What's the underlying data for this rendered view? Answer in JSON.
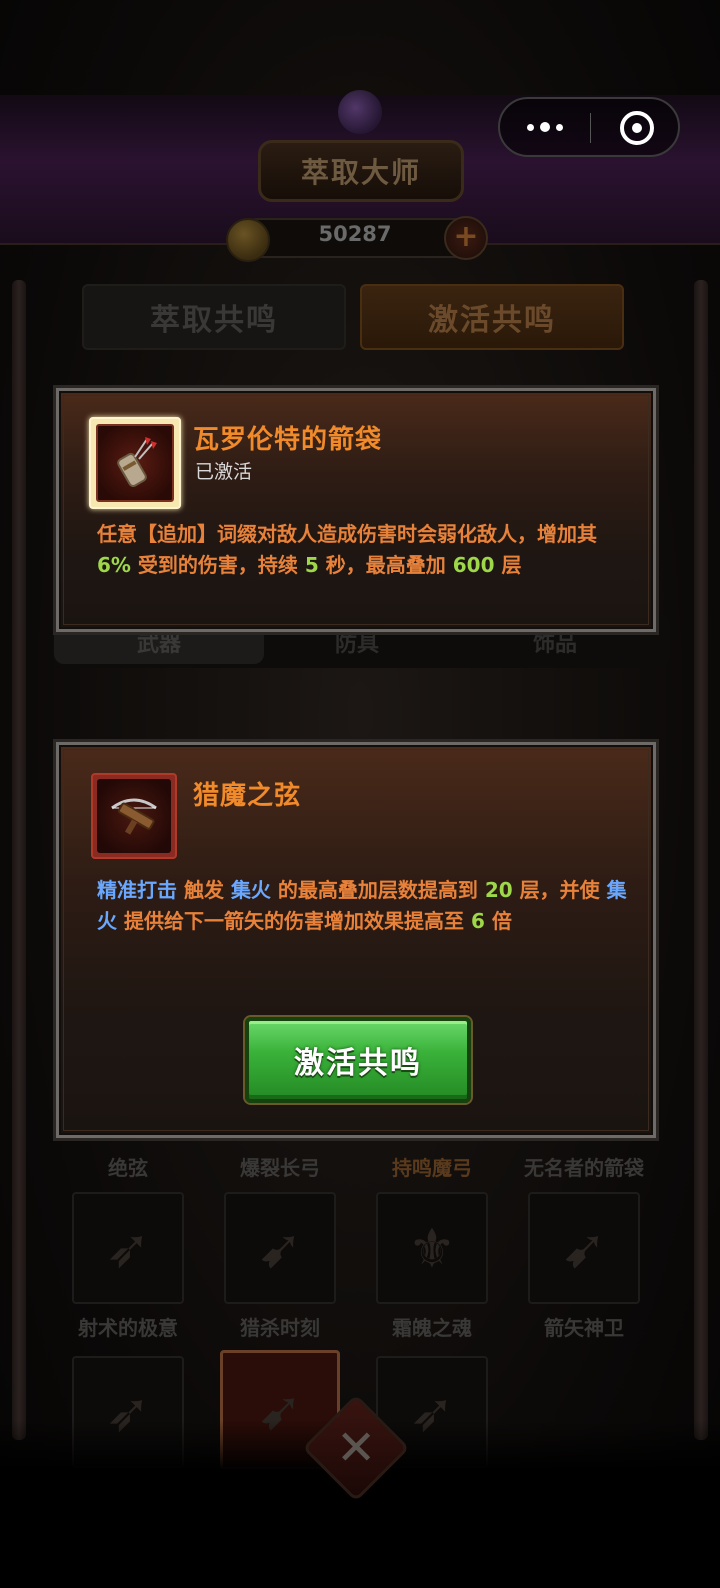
{
  "background": {
    "title": "萃取大师",
    "currency_amount": "50287",
    "tabs": [
      "萃取共鸣",
      "激活共鸣"
    ],
    "sub_tabs": [
      "武器",
      "防具",
      "饰品"
    ],
    "slot_labels_row1": [
      "绝弦",
      "爆裂长弓",
      "持鸣魔弓",
      "无名者的箭袋"
    ],
    "slot_labels_row2": [
      "射术的极意",
      "猎杀时刻",
      "霜魄之魂",
      "箭矢神卫"
    ]
  },
  "capsule": {
    "more_icon": "more-dots-icon",
    "close_icon": "target-circle-icon"
  },
  "panel_quiver": {
    "name": "瓦罗伦特的箭袋",
    "status": "已激活",
    "desc": {
      "p1": "任意【追加】词缀对敌人造成伤害时会弱化敌人，增加其 ",
      "v1": "6%",
      "p2": " 受到的伤害，持续 ",
      "v2": "5",
      "p3": " 秒，最高叠加 ",
      "v3": "600",
      "p4": " 层"
    }
  },
  "panel_bow": {
    "name": "猎魔之弦",
    "desc": {
      "k1": "精准打击",
      "p1": " 触发 ",
      "k2": "集火",
      "p2": " 的最高叠加层数提高到 ",
      "v1": "20",
      "p3": " 层，并使 ",
      "k3": "集火",
      "p4": " 提供给下一箭矢的伤害增加效果提高至 ",
      "v2": "6",
      "p5": " 倍"
    },
    "button_label": "激活共鸣",
    "button_color": "#3ab23a"
  },
  "colors": {
    "item_name": "#f08a2a",
    "number": "#9ed84a",
    "keyword": "#6aa8ff"
  }
}
